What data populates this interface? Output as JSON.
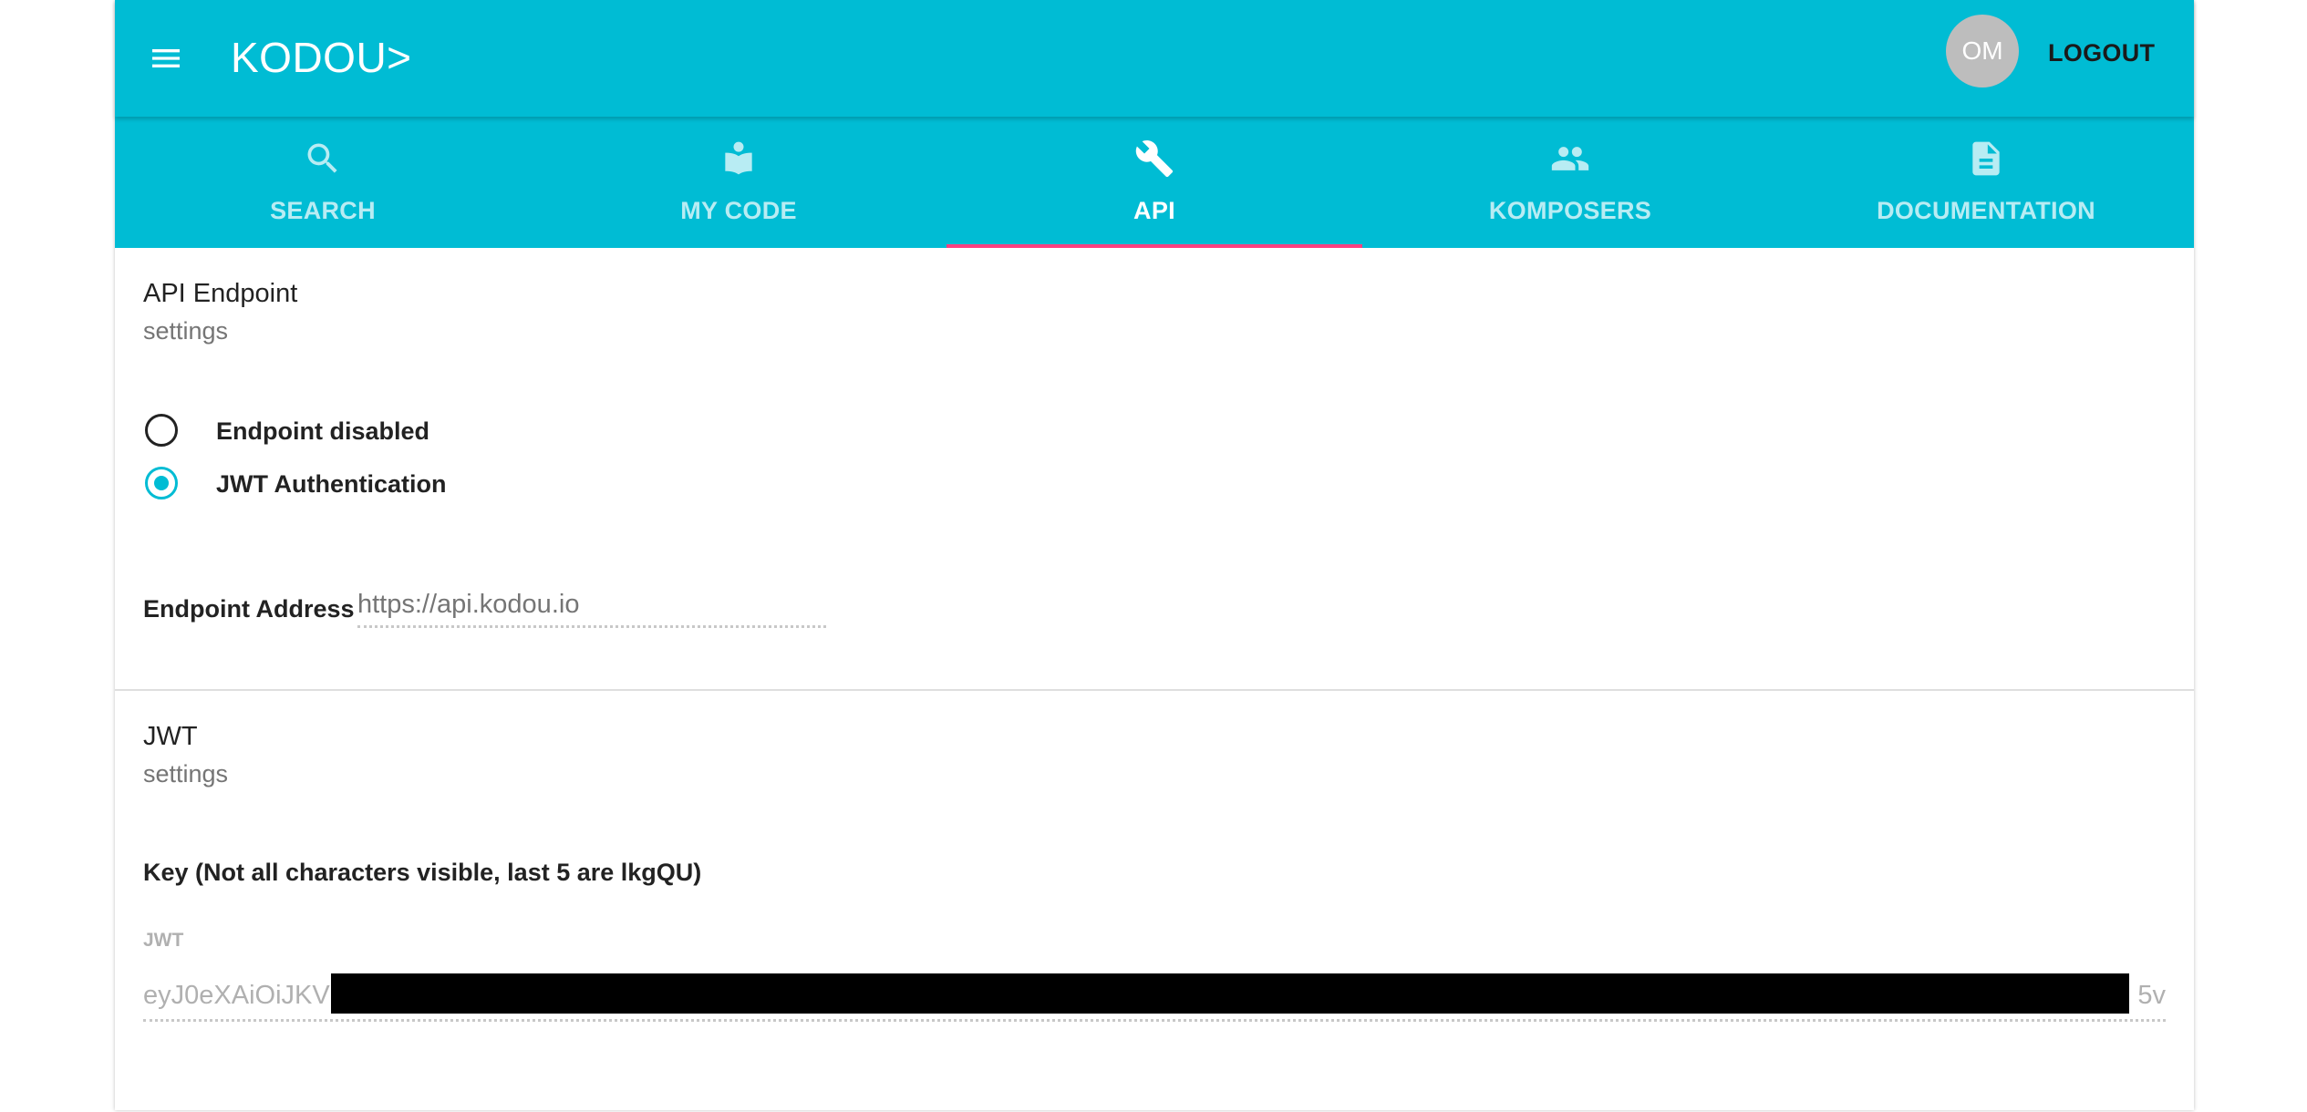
{
  "header": {
    "brand": "KODOU>",
    "avatar_initials": "OM",
    "logout_label": "LOGOUT",
    "bar_color": "#00bcd4"
  },
  "tabs": [
    {
      "label": "SEARCH",
      "icon": "search-icon",
      "active": false
    },
    {
      "label": "MY CODE",
      "icon": "book-reader-icon",
      "active": false
    },
    {
      "label": "API",
      "icon": "wrench-icon",
      "active": true
    },
    {
      "label": "KOMPOSERS",
      "icon": "people-icon",
      "active": false
    },
    {
      "label": "DOCUMENTATION",
      "icon": "document-icon",
      "active": false
    }
  ],
  "tab_indicator_color": "#ff4081",
  "api_endpoint": {
    "title": "API Endpoint",
    "subtitle": "settings",
    "options": [
      {
        "label": "Endpoint disabled",
        "selected": false
      },
      {
        "label": "JWT Authentication",
        "selected": true
      }
    ],
    "address_label": "Endpoint Address",
    "address_placeholder": "https://api.kodou.io"
  },
  "jwt": {
    "title": "JWT",
    "subtitle": "settings",
    "key_label": "Key (Not all characters visible, last 5 are lkgQU)",
    "field_label": "JWT",
    "value_start": "eyJ0eXAiOiJKV",
    "value_end": "5v"
  }
}
